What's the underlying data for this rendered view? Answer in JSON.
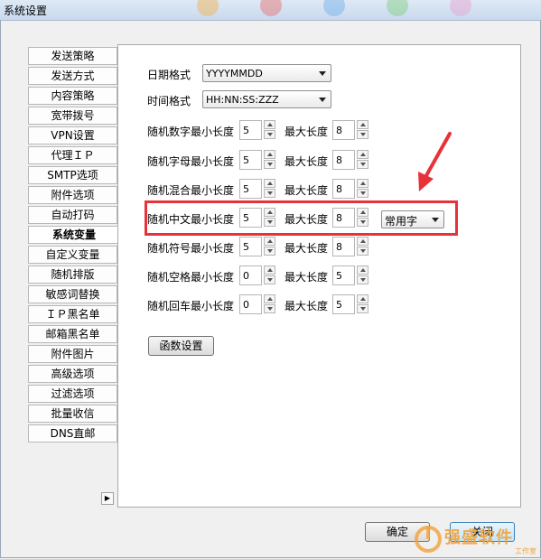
{
  "window": {
    "title": "系统设置"
  },
  "tabs": [
    {
      "label": "发送策略"
    },
    {
      "label": "发送方式"
    },
    {
      "label": "内容策略"
    },
    {
      "label": "宽带拨号"
    },
    {
      "label": "VPN设置"
    },
    {
      "label": "代理ＩＰ"
    },
    {
      "label": "SMTP选项"
    },
    {
      "label": "附件选项"
    },
    {
      "label": "自动打码"
    },
    {
      "label": "系统变量",
      "active": true
    },
    {
      "label": "自定义变量"
    },
    {
      "label": "随机排版"
    },
    {
      "label": "敏感词替换"
    },
    {
      "label": "ＩＰ黑名单"
    },
    {
      "label": "邮箱黑名单"
    },
    {
      "label": "附件图片"
    },
    {
      "label": "高级选项"
    },
    {
      "label": "过滤选项"
    },
    {
      "label": "批量收信"
    },
    {
      "label": "DNS直邮"
    }
  ],
  "date_format": {
    "label": "日期格式",
    "value": "YYYYMMDD"
  },
  "time_format": {
    "label": "时间格式",
    "value": "HH:NN:SS:ZZZ"
  },
  "max_label": "最大长度",
  "rows": [
    {
      "label": "随机数字最小长度",
      "min": "5",
      "max": "8"
    },
    {
      "label": "随机字母最小长度",
      "min": "5",
      "max": "8"
    },
    {
      "label": "随机混合最小长度",
      "min": "5",
      "max": "8"
    },
    {
      "label": "随机中文最小长度",
      "min": "5",
      "max": "8"
    },
    {
      "label": "随机符号最小长度",
      "min": "5",
      "max": "8"
    },
    {
      "label": "随机空格最小长度",
      "min": "0",
      "max": "5"
    },
    {
      "label": "随机回车最小长度",
      "min": "0",
      "max": "5"
    }
  ],
  "chinese_charset": {
    "value": "常用字"
  },
  "function_button": "函数设置",
  "ok_button": "确定",
  "close_button": "关闭",
  "watermark": {
    "text": "强盛软件",
    "sub": "工作室"
  },
  "colors": {
    "highlight": "#e8323a",
    "arrow": "#e8323a",
    "watermark": "#f2a13a"
  }
}
